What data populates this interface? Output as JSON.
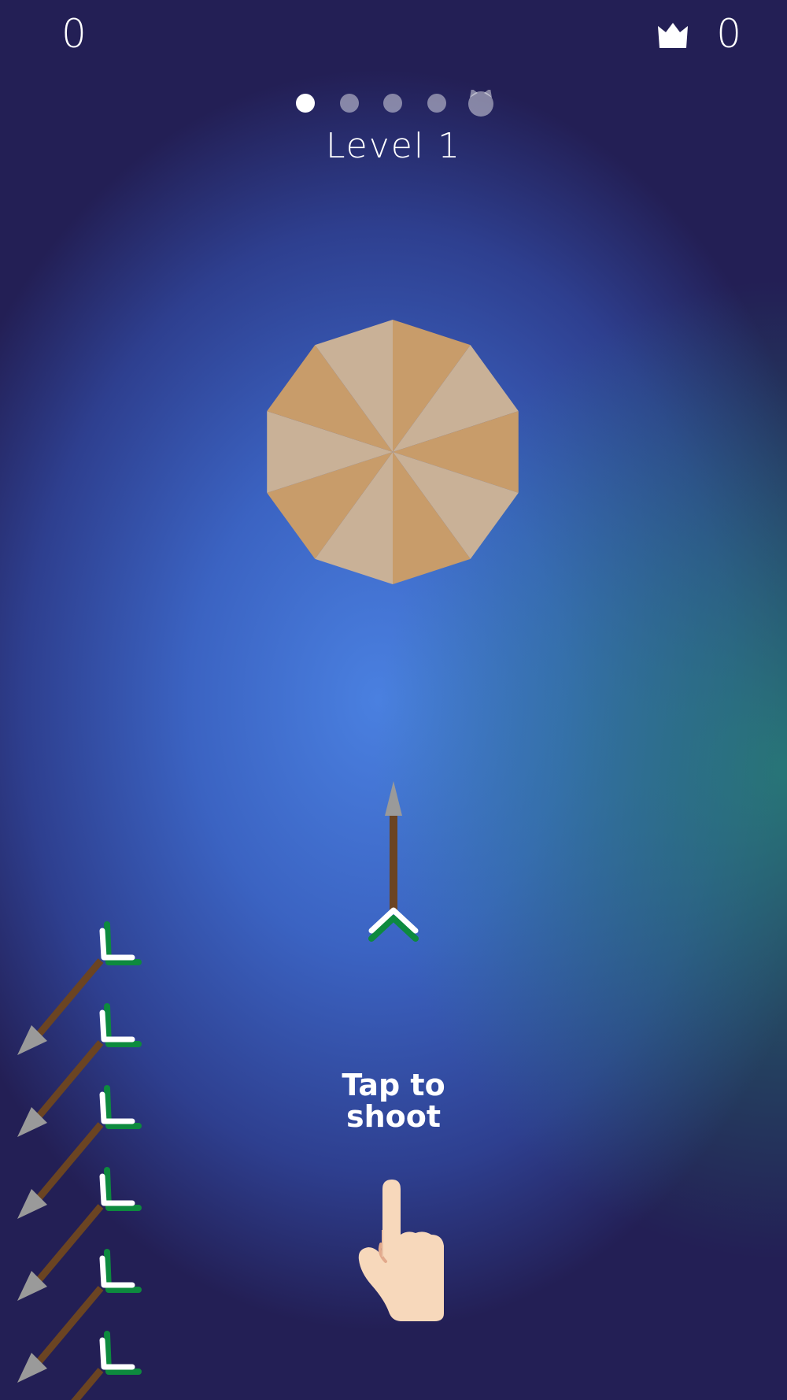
{
  "hud": {
    "score": "0",
    "best_score": "0"
  },
  "progress": {
    "stages": 5,
    "current": 1,
    "boss_stage": 5
  },
  "level_label": "Level 1",
  "target": {
    "segments": 10,
    "colors": [
      "#c89c6a",
      "#c9b197"
    ]
  },
  "arrows_remaining": 6,
  "hint": {
    "line1": "Tap to",
    "line2": "shoot"
  },
  "colors": {
    "shaft": "#6b4422",
    "tip": "#9a9a9a",
    "fletch_green": "#0d8a3e",
    "fletch_white": "#ffffff",
    "skin": "#f7d8bb"
  }
}
